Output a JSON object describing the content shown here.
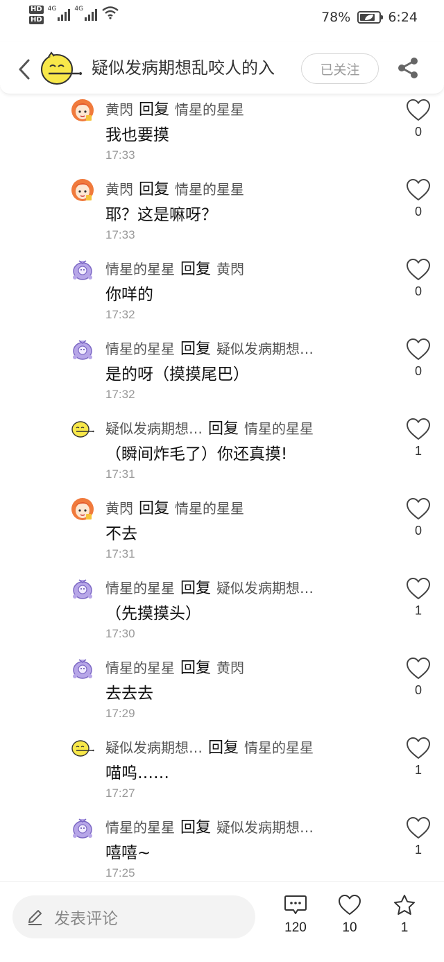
{
  "status_bar": {
    "hd1": "HD",
    "hd2": "HD",
    "net1": "4G",
    "net2": "4G",
    "battery": "78%",
    "battery_level": 0.78,
    "time": "6:24"
  },
  "header": {
    "title": "疑似发病期想乱咬人的入",
    "follow_label": "已关注",
    "icons": [
      "back-icon",
      "share-icon"
    ]
  },
  "comments": [
    {
      "user": "黄閃",
      "reply_label": "回复",
      "target": "情星的星星",
      "text": "我也要摸",
      "time": "17:33",
      "likes": "0",
      "avatar": "orange-girl"
    },
    {
      "user": "黄閃",
      "reply_label": "回复",
      "target": "情星的星星",
      "text": "耶？这是嘛呀？",
      "time": "17:33",
      "likes": "0",
      "avatar": "orange-girl"
    },
    {
      "user": "情星的星星",
      "reply_label": "回复",
      "target": "黄閃",
      "text": "你咩的",
      "time": "17:32",
      "likes": "0",
      "avatar": "purple-creature"
    },
    {
      "user": "情星的星星",
      "reply_label": "回复",
      "target": "疑似发病期想…",
      "text": "是的呀（摸摸尾巴）",
      "time": "17:32",
      "likes": "0",
      "avatar": "purple-creature"
    },
    {
      "user": "疑似发病期想…",
      "reply_label": "回复",
      "target": "情星的星星",
      "text": "（瞬间炸毛了）你还真摸!",
      "time": "17:31",
      "likes": "1",
      "avatar": "yellow-face"
    },
    {
      "user": "黄閃",
      "reply_label": "回复",
      "target": "情星的星星",
      "text": "不去",
      "time": "17:31",
      "likes": "0",
      "avatar": "orange-girl"
    },
    {
      "user": "情星的星星",
      "reply_label": "回复",
      "target": "疑似发病期想…",
      "text": "（先摸摸头）",
      "time": "17:30",
      "likes": "1",
      "avatar": "purple-creature"
    },
    {
      "user": "情星的星星",
      "reply_label": "回复",
      "target": "黄閃",
      "text": "去去去",
      "time": "17:29",
      "likes": "0",
      "avatar": "purple-creature"
    },
    {
      "user": "疑似发病期想…",
      "reply_label": "回复",
      "target": "情星的星星",
      "text": "喵呜……",
      "time": "17:27",
      "likes": "1",
      "avatar": "yellow-face"
    },
    {
      "user": "情星的星星",
      "reply_label": "回复",
      "target": "疑似发病期想…",
      "text": "嘻嘻~",
      "time": "17:25",
      "likes": "1",
      "avatar": "purple-creature"
    }
  ],
  "bottom_bar": {
    "placeholder": "发表评论",
    "comment_count": "120",
    "like_count": "10",
    "favorite_count": "1"
  }
}
